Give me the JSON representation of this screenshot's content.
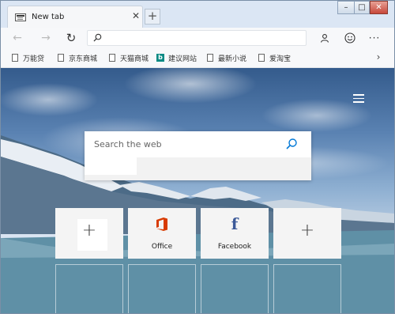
{
  "tab": {
    "title": "New tab",
    "close": "✕"
  },
  "newtab_button": "+",
  "window_controls": {
    "minimize": "–",
    "maximize": "□",
    "close": "✕"
  },
  "toolbar": {
    "back": "←",
    "forward": "→",
    "reload": "↻",
    "profile": "⚇",
    "emoji": "☺",
    "more": "···"
  },
  "address": {
    "value": ""
  },
  "favorites": [
    {
      "label": "万能贷",
      "icon": "page-icon"
    },
    {
      "label": "京东商城",
      "icon": "page-icon"
    },
    {
      "label": "天猫商城",
      "icon": "page-icon"
    },
    {
      "label": "建议网站",
      "icon": "bing-icon"
    },
    {
      "label": "最新小说",
      "icon": "page-icon"
    },
    {
      "label": "爱淘宝",
      "icon": "page-icon"
    }
  ],
  "favorites_overflow": "›",
  "search": {
    "placeholder": "Search the web"
  },
  "tiles": [
    {
      "label": "",
      "icon": "plus-icon",
      "glyph": "+"
    },
    {
      "label": "Office",
      "icon": "office-icon"
    },
    {
      "label": "Facebook",
      "icon": "facebook-icon",
      "glyph": "f"
    },
    {
      "label": "",
      "icon": "plus-icon",
      "glyph": "+"
    }
  ],
  "colors": {
    "office": "#d83b01",
    "facebook": "#3b5998",
    "search_accent": "#0078d7"
  }
}
